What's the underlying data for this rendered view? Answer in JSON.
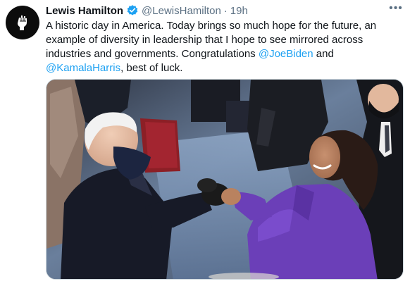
{
  "tweet": {
    "author_name": "Lewis Hamilton",
    "handle": "@LewisHamilton",
    "separator": "·",
    "time": "19h",
    "more_label": "•••",
    "text_part1": "A historic day in America. Today brings so much hope for the future, an example of diversity in leadership that I hope to see mirrored across industries and governments. Congratulations ",
    "mention1": "@JoeBiden",
    "text_part2": " and ",
    "mention2": "@KamalaHarris",
    "text_part3": ", best of luck."
  },
  "icons": {
    "avatar": "raised-fist-icon",
    "verified": "verified-badge-icon",
    "more": "more-options-icon"
  },
  "colors": {
    "link": "#1da1f2",
    "secondary_text": "#5b7083",
    "verified": "#1da1f2",
    "kamala_coat": "#6b3fb8"
  }
}
